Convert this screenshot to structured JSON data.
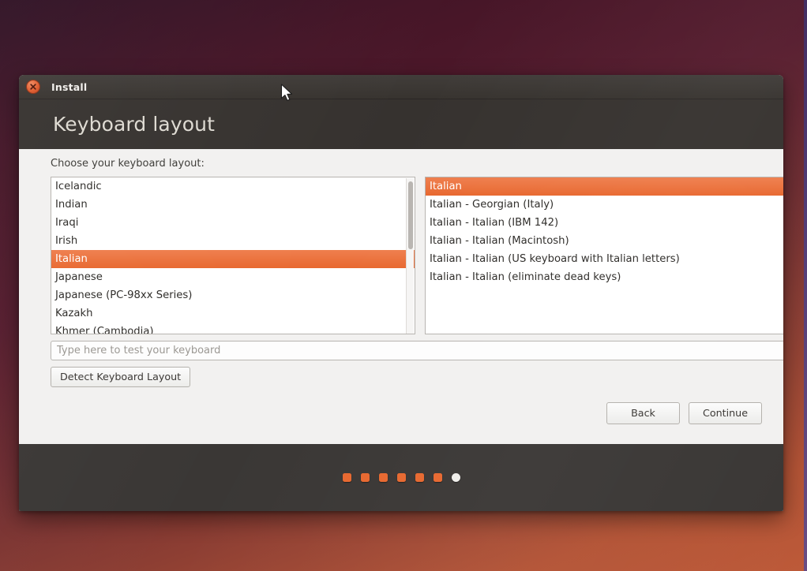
{
  "window": {
    "titlebar_title": "Install",
    "close_icon": "close-icon",
    "page_title": "Keyboard layout"
  },
  "body": {
    "choose_label": "Choose your keyboard layout:",
    "test_input_placeholder": "Type here to test your keyboard",
    "test_input_value": "",
    "detect_button": "Detect Keyboard Layout"
  },
  "layout_list": {
    "selected_index": 4,
    "items": [
      "Icelandic",
      "Indian",
      "Iraqi",
      "Irish",
      "Italian",
      "Japanese",
      "Japanese (PC-98xx Series)",
      "Kazakh",
      "Khmer (Cambodia)"
    ]
  },
  "variant_list": {
    "selected_index": 0,
    "items": [
      "Italian",
      "Italian - Georgian (Italy)",
      "Italian - Italian (IBM 142)",
      "Italian - Italian (Macintosh)",
      "Italian - Italian (US keyboard with Italian letters)",
      "Italian - Italian (eliminate dead keys)"
    ]
  },
  "nav": {
    "back_label": "Back",
    "continue_label": "Continue"
  },
  "progress": {
    "total_steps": 7,
    "current_step": 7,
    "dot_states": [
      "done",
      "done",
      "done",
      "done",
      "done",
      "done",
      "active"
    ]
  },
  "colors": {
    "accent_orange": "#e8682f",
    "selection_orange": "#ef7f4e",
    "header_dark": "#36322f",
    "titlebar_dark": "#37332f",
    "footer_dark": "#3a3735",
    "body_gray": "#f2f1f0",
    "desktop_top": "#2d0f22",
    "desktop_bottom": "#bd5a39"
  }
}
